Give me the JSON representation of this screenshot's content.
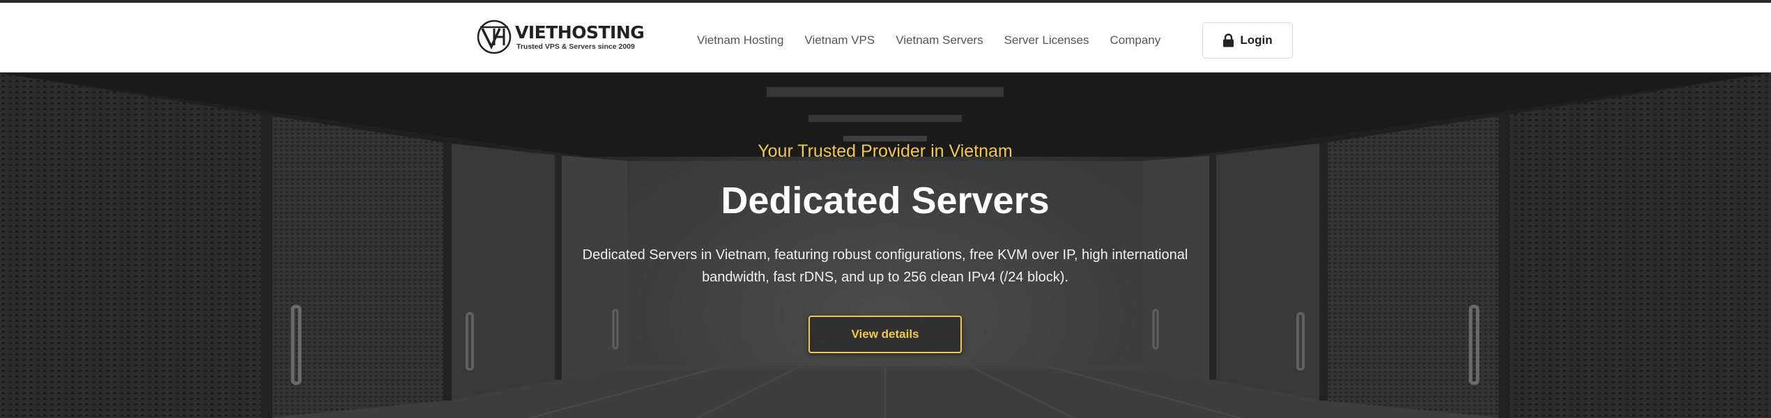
{
  "brand": {
    "name": "VIETHOSTING",
    "tagline": "Trusted VPS & Servers since 2009"
  },
  "nav": {
    "items": [
      {
        "label": "Vietnam Hosting"
      },
      {
        "label": "Vietnam VPS"
      },
      {
        "label": "Vietnam Servers"
      },
      {
        "label": "Server Licenses"
      },
      {
        "label": "Company"
      }
    ],
    "login_label": "Login",
    "login_icon": "lock-icon"
  },
  "hero": {
    "subtitle": "Your Trusted Provider in Vietnam",
    "title": "Dedicated Servers",
    "description": "Dedicated Servers in Vietnam, featuring robust configurations, free KVM over IP, high international bandwidth, fast rDNS, and up to 256 clean IPv4 (/24 block).",
    "cta_label": "View details"
  },
  "colors": {
    "accent": "#f2c84b",
    "navbar_bg": "#ffffff",
    "hero_text": "#ffffff"
  }
}
